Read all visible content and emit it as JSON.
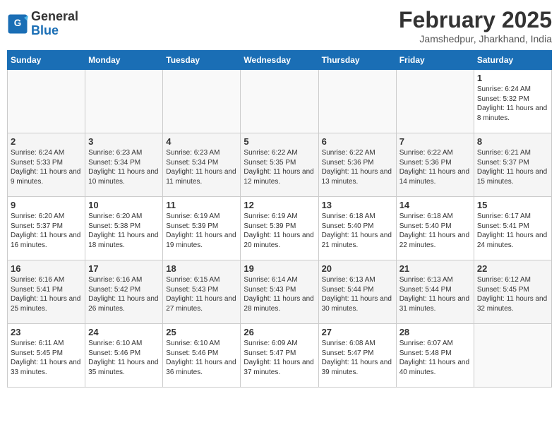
{
  "logo": {
    "line1": "General",
    "line2": "Blue"
  },
  "title": "February 2025",
  "subtitle": "Jamshedpur, Jharkhand, India",
  "days_header": [
    "Sunday",
    "Monday",
    "Tuesday",
    "Wednesday",
    "Thursday",
    "Friday",
    "Saturday"
  ],
  "weeks": [
    [
      {
        "num": "",
        "info": ""
      },
      {
        "num": "",
        "info": ""
      },
      {
        "num": "",
        "info": ""
      },
      {
        "num": "",
        "info": ""
      },
      {
        "num": "",
        "info": ""
      },
      {
        "num": "",
        "info": ""
      },
      {
        "num": "1",
        "info": "Sunrise: 6:24 AM\nSunset: 5:32 PM\nDaylight: 11 hours and 8 minutes."
      }
    ],
    [
      {
        "num": "2",
        "info": "Sunrise: 6:24 AM\nSunset: 5:33 PM\nDaylight: 11 hours and 9 minutes."
      },
      {
        "num": "3",
        "info": "Sunrise: 6:23 AM\nSunset: 5:34 PM\nDaylight: 11 hours and 10 minutes."
      },
      {
        "num": "4",
        "info": "Sunrise: 6:23 AM\nSunset: 5:34 PM\nDaylight: 11 hours and 11 minutes."
      },
      {
        "num": "5",
        "info": "Sunrise: 6:22 AM\nSunset: 5:35 PM\nDaylight: 11 hours and 12 minutes."
      },
      {
        "num": "6",
        "info": "Sunrise: 6:22 AM\nSunset: 5:36 PM\nDaylight: 11 hours and 13 minutes."
      },
      {
        "num": "7",
        "info": "Sunrise: 6:22 AM\nSunset: 5:36 PM\nDaylight: 11 hours and 14 minutes."
      },
      {
        "num": "8",
        "info": "Sunrise: 6:21 AM\nSunset: 5:37 PM\nDaylight: 11 hours and 15 minutes."
      }
    ],
    [
      {
        "num": "9",
        "info": "Sunrise: 6:20 AM\nSunset: 5:37 PM\nDaylight: 11 hours and 16 minutes."
      },
      {
        "num": "10",
        "info": "Sunrise: 6:20 AM\nSunset: 5:38 PM\nDaylight: 11 hours and 18 minutes."
      },
      {
        "num": "11",
        "info": "Sunrise: 6:19 AM\nSunset: 5:39 PM\nDaylight: 11 hours and 19 minutes."
      },
      {
        "num": "12",
        "info": "Sunrise: 6:19 AM\nSunset: 5:39 PM\nDaylight: 11 hours and 20 minutes."
      },
      {
        "num": "13",
        "info": "Sunrise: 6:18 AM\nSunset: 5:40 PM\nDaylight: 11 hours and 21 minutes."
      },
      {
        "num": "14",
        "info": "Sunrise: 6:18 AM\nSunset: 5:40 PM\nDaylight: 11 hours and 22 minutes."
      },
      {
        "num": "15",
        "info": "Sunrise: 6:17 AM\nSunset: 5:41 PM\nDaylight: 11 hours and 24 minutes."
      }
    ],
    [
      {
        "num": "16",
        "info": "Sunrise: 6:16 AM\nSunset: 5:41 PM\nDaylight: 11 hours and 25 minutes."
      },
      {
        "num": "17",
        "info": "Sunrise: 6:16 AM\nSunset: 5:42 PM\nDaylight: 11 hours and 26 minutes."
      },
      {
        "num": "18",
        "info": "Sunrise: 6:15 AM\nSunset: 5:43 PM\nDaylight: 11 hours and 27 minutes."
      },
      {
        "num": "19",
        "info": "Sunrise: 6:14 AM\nSunset: 5:43 PM\nDaylight: 11 hours and 28 minutes."
      },
      {
        "num": "20",
        "info": "Sunrise: 6:13 AM\nSunset: 5:44 PM\nDaylight: 11 hours and 30 minutes."
      },
      {
        "num": "21",
        "info": "Sunrise: 6:13 AM\nSunset: 5:44 PM\nDaylight: 11 hours and 31 minutes."
      },
      {
        "num": "22",
        "info": "Sunrise: 6:12 AM\nSunset: 5:45 PM\nDaylight: 11 hours and 32 minutes."
      }
    ],
    [
      {
        "num": "23",
        "info": "Sunrise: 6:11 AM\nSunset: 5:45 PM\nDaylight: 11 hours and 33 minutes."
      },
      {
        "num": "24",
        "info": "Sunrise: 6:10 AM\nSunset: 5:46 PM\nDaylight: 11 hours and 35 minutes."
      },
      {
        "num": "25",
        "info": "Sunrise: 6:10 AM\nSunset: 5:46 PM\nDaylight: 11 hours and 36 minutes."
      },
      {
        "num": "26",
        "info": "Sunrise: 6:09 AM\nSunset: 5:47 PM\nDaylight: 11 hours and 37 minutes."
      },
      {
        "num": "27",
        "info": "Sunrise: 6:08 AM\nSunset: 5:47 PM\nDaylight: 11 hours and 39 minutes."
      },
      {
        "num": "28",
        "info": "Sunrise: 6:07 AM\nSunset: 5:48 PM\nDaylight: 11 hours and 40 minutes."
      },
      {
        "num": "",
        "info": ""
      }
    ]
  ]
}
